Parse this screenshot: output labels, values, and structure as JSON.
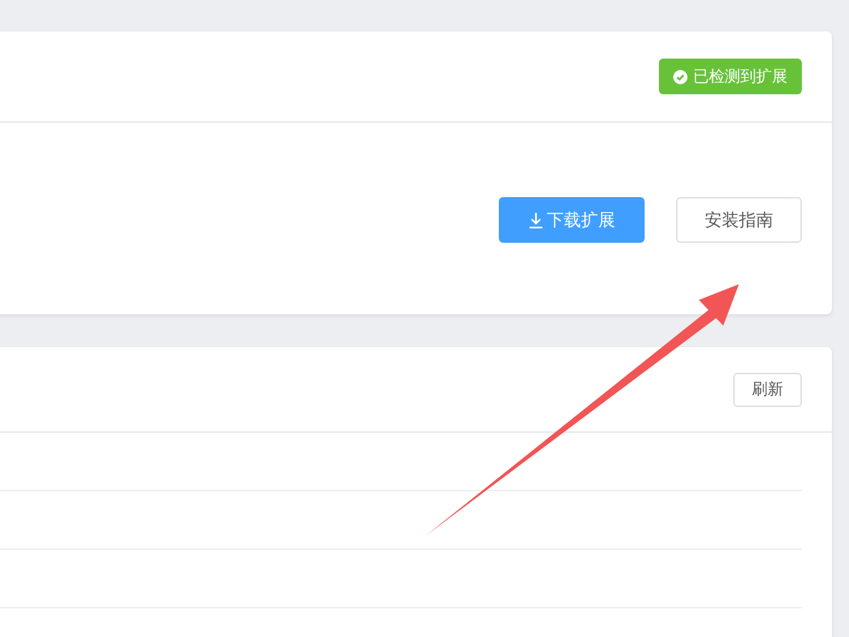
{
  "extension_card": {
    "status_badge": {
      "label": "已检测到扩展",
      "detected": true
    },
    "buttons": [
      {
        "kind": "primary",
        "label": "下载扩展"
      },
      {
        "kind": "plain",
        "label": "安装指南"
      }
    ]
  },
  "list_card": {
    "refresh_button": {
      "label": "刷新"
    }
  }
}
